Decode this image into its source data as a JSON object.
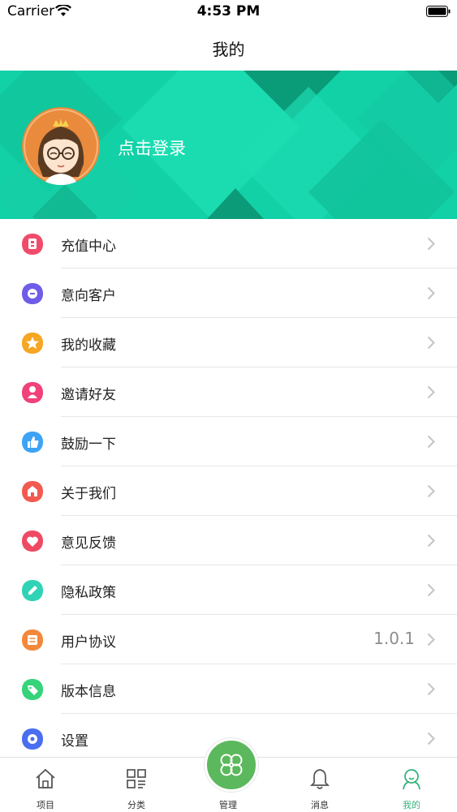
{
  "status_bar": {
    "carrier": "Carrier",
    "time": "4:53 PM"
  },
  "nav": {
    "title": "我的"
  },
  "profile": {
    "login_text": "点击登录"
  },
  "colors": {
    "accent": "#36b37e",
    "banner": "#12d1a7",
    "center_button": "#5cb85c"
  },
  "menu": [
    {
      "label": "充值中心",
      "icon": "recharge-icon",
      "color": "#f04b6b"
    },
    {
      "label": "意向客户",
      "icon": "customer-icon",
      "color": "#6f5de8"
    },
    {
      "label": "我的收藏",
      "icon": "star-icon",
      "color": "#f5a623"
    },
    {
      "label": "邀请好友",
      "icon": "invite-icon",
      "color": "#f0417a"
    },
    {
      "label": "鼓励一下",
      "icon": "thumbs-up-icon",
      "color": "#3da3f5"
    },
    {
      "label": "关于我们",
      "icon": "about-icon",
      "color": "#f25a50"
    },
    {
      "label": "意见反馈",
      "icon": "feedback-icon",
      "color": "#ef4a64"
    },
    {
      "label": "隐私政策",
      "icon": "privacy-icon",
      "color": "#30d3b5"
    },
    {
      "label": "用户协议",
      "icon": "agreement-icon",
      "color": "#f4883a",
      "value": "1.0.1"
    },
    {
      "label": "版本信息",
      "icon": "version-tag-icon",
      "color": "#36d37a"
    },
    {
      "label": "设置",
      "icon": "settings-icon",
      "color": "#4a6ef0"
    }
  ],
  "tabs": [
    {
      "label": "项目",
      "icon": "home-icon"
    },
    {
      "label": "分类",
      "icon": "category-icon"
    },
    {
      "label": "管理",
      "icon": "clover-icon"
    },
    {
      "label": "消息",
      "icon": "bell-icon"
    },
    {
      "label": "我的",
      "icon": "user-icon",
      "active": true
    }
  ]
}
